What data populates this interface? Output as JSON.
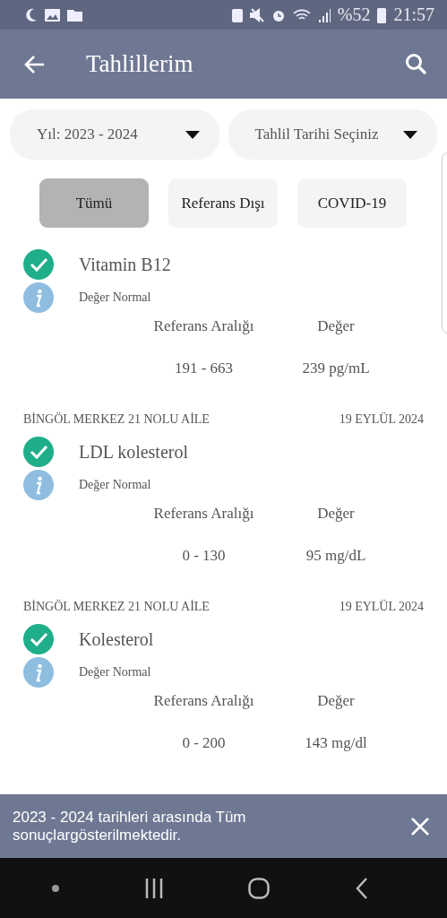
{
  "status_bar": {
    "battery": "%52",
    "time": "21:57"
  },
  "app_bar": {
    "title": "Tahlillerim"
  },
  "filters": [
    {
      "label": "Yıl: 2023 - 2024"
    },
    {
      "label": "Tahlil Tarihi Seçiniz"
    }
  ],
  "tabs": [
    {
      "label": "Tümü",
      "selected": true
    },
    {
      "label": "Referans Dışı",
      "selected": false
    },
    {
      "label": "COVID-19",
      "selected": false
    }
  ],
  "results": [
    {
      "name": "Vitamin B12",
      "normal": true,
      "status": "Değer Normal",
      "range_label": "Referans Aralığı",
      "value_label": "Değer",
      "range": "191 - 663",
      "value": "239 pg/mL"
    },
    {
      "place": "BİNGÖL MERKEZ 21 NOLU AİLE",
      "date": "19 EYLÜL 2024",
      "name": "LDL kolesterol",
      "normal": true,
      "status": "Değer Normal",
      "range_label": "Referans Aralığı",
      "value_label": "Değer",
      "range": "0 - 130",
      "value": "95 mg/dL"
    },
    {
      "place": "BİNGÖL MERKEZ 21 NOLU AİLE",
      "date": "19 EYLÜL 2024",
      "name": "Kolesterol",
      "normal": true,
      "status": "Değer Normal",
      "range_label": "Referans Aralığı",
      "value_label": "Değer",
      "range": "0 - 200",
      "value": "143 mg/dl"
    }
  ],
  "snackbar": {
    "message": "2023 - 2024 tarihleri arasında Tüm sonuçlargösterilmektedir."
  }
}
